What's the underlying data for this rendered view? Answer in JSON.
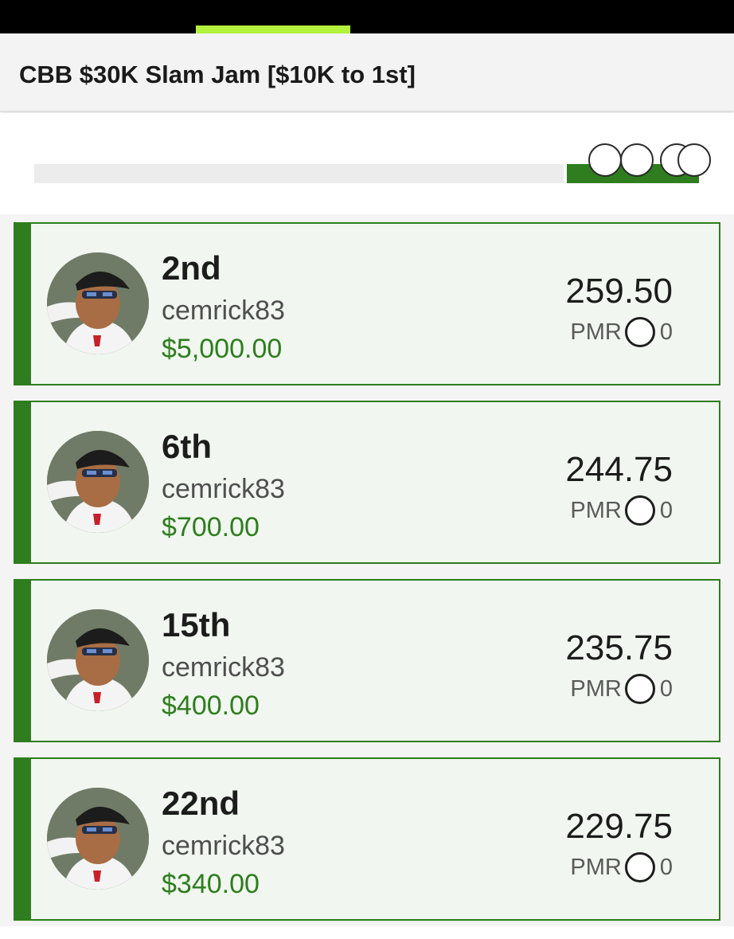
{
  "contest": {
    "title": "CBB $30K Slam Jam [$10K to 1st]"
  },
  "progress": {
    "fraction_complete": 0.95,
    "markers": 4
  },
  "pmr_label": "PMR",
  "entries": [
    {
      "rank": "2nd",
      "username": "cemrick83",
      "winnings": "$5,000.00",
      "score": "259.50",
      "pmr": "0"
    },
    {
      "rank": "6th",
      "username": "cemrick83",
      "winnings": "$700.00",
      "score": "244.75",
      "pmr": "0"
    },
    {
      "rank": "15th",
      "username": "cemrick83",
      "winnings": "$400.00",
      "score": "235.75",
      "pmr": "0"
    },
    {
      "rank": "22nd",
      "username": "cemrick83",
      "winnings": "$340.00",
      "score": "229.75",
      "pmr": "0"
    }
  ],
  "colors": {
    "brand_green": "#2e7d1e",
    "tab_indicator": "#b3f23c",
    "card_background": "#f1f7f0"
  }
}
